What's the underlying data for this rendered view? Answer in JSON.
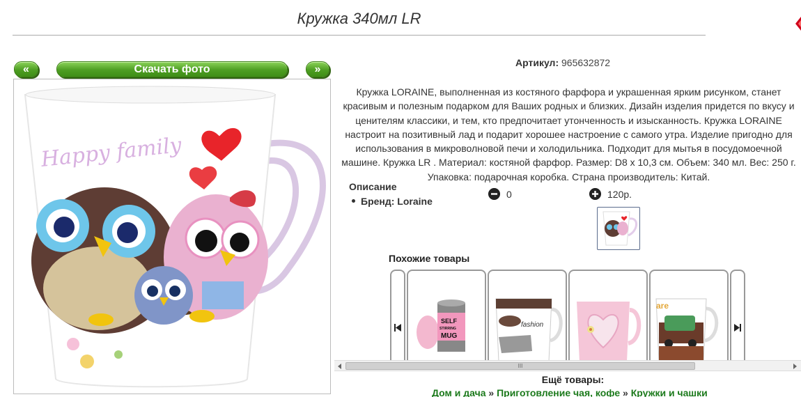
{
  "product": {
    "title": "Кружка 340мл LR",
    "sku_label": "Артикул:",
    "sku_value": "965632872",
    "description": "Кружка LORAINE, выполненная из костяного фарфора и украшенная ярким рисунком, станет красивым и полезным подарком для Ваших родных и близких. Дизайн изделия придется по вкусу и ценителям классики, и тем, кто предпочитает утонченность и изысканность. Кружка LORAINE настроит на позитивный лад и подарит хорошее настроение с самого утра. Изделие пригодно для использования в микроволновой печи и холодильника. Подходит для мытья в посудомоечной машине. Кружка LR . Материал: костяной фарфор. Размер: D8 х 10,3 см. Объем: 340 мл. Вес: 250 г. Упаковка: подарочная коробка. Страна производитель: Китай.",
    "mug_text": "Happy family"
  },
  "gallery": {
    "prev_label": "«",
    "download_label": "Скачать фото",
    "next_label": "»"
  },
  "specs": {
    "heading": "Описание",
    "brand_line": "Бренд: Loraine"
  },
  "cart": {
    "qty_value": "0",
    "price_value": "120р."
  },
  "similar": {
    "heading": "Похожие товары",
    "card1_text_line1": "SELF",
    "card1_text_line2": "STIRRING",
    "card1_text_line3": "MUG",
    "card2_text": "fashion",
    "card4_text": "are"
  },
  "scroll": {
    "grip": "III"
  },
  "more": {
    "heading": "Ещё товары:",
    "crumbs": [
      "Дом и дача",
      "Приготовление чая, кофе",
      "Кружки и чашки"
    ],
    "separator": "»"
  },
  "colors": {
    "accent_green": "#4d9e22",
    "link_green": "#1c7a1c"
  }
}
